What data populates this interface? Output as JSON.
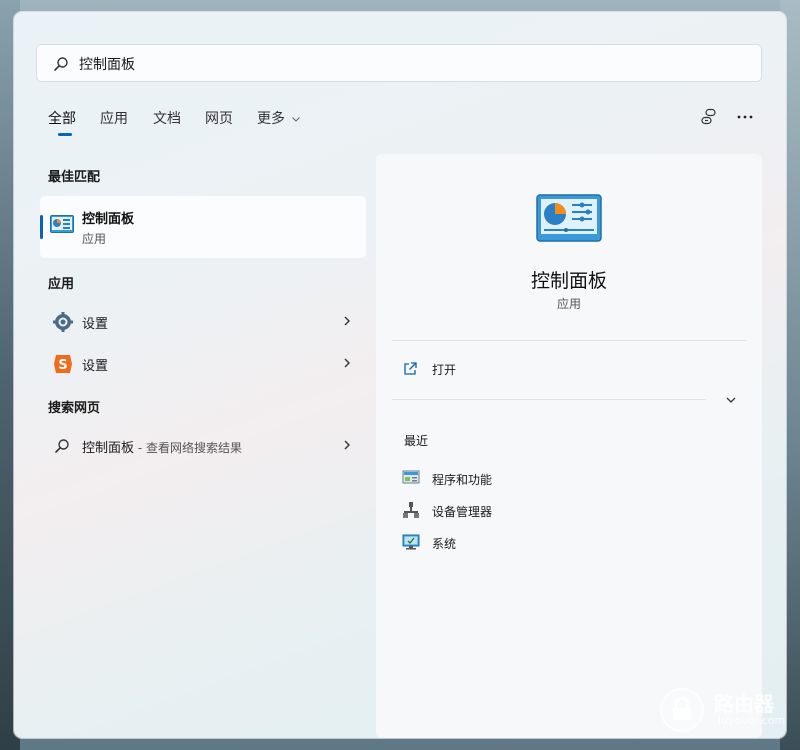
{
  "search": {
    "query": "控制面板"
  },
  "tabs": [
    {
      "label": "全部",
      "active": true
    },
    {
      "label": "应用"
    },
    {
      "label": "文档"
    },
    {
      "label": "网页"
    },
    {
      "label": "更多"
    }
  ],
  "best_match": {
    "title": "最佳匹配",
    "name": "控制面板",
    "type": "应用"
  },
  "apps": {
    "title": "应用",
    "items": [
      {
        "label": "设置",
        "icon": "settings-gear-icon"
      },
      {
        "label": "设置",
        "icon": "sogou-s-icon"
      }
    ]
  },
  "web": {
    "title": "搜索网页",
    "query": "控制面板",
    "desc": " - 查看网络搜索结果"
  },
  "detail": {
    "title": "控制面板",
    "type": "应用",
    "open_label": "打开",
    "recent_title": "最近",
    "recent": [
      {
        "label": "程序和功能",
        "icon": "programs-features-icon"
      },
      {
        "label": "设备管理器",
        "icon": "device-manager-icon"
      },
      {
        "label": "系统",
        "icon": "system-monitor-icon"
      }
    ]
  },
  "watermark": {
    "title": "路由器",
    "domain": "luyouqi.com"
  },
  "colors": {
    "accent": "#0a64b4",
    "sogou": "#f26b1d"
  }
}
